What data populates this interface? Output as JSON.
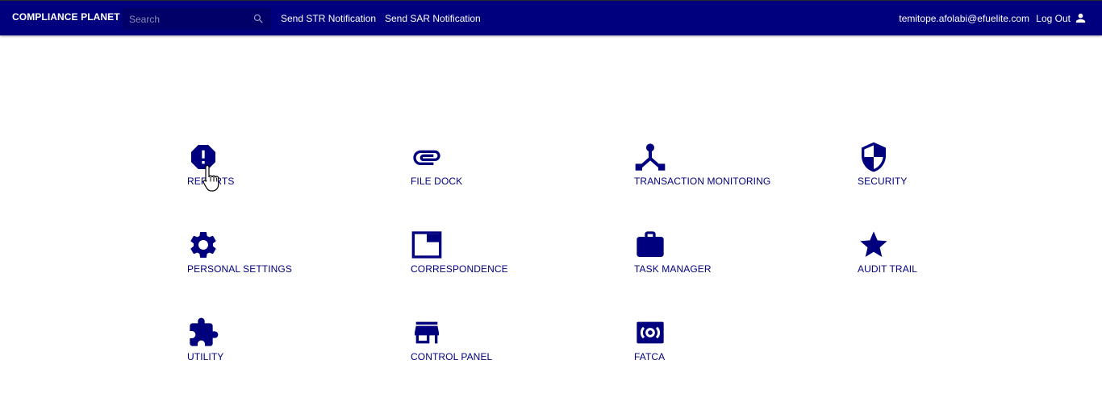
{
  "header": {
    "brand": "COMPLIANCE PLANET",
    "search_placeholder": "Search",
    "search_icon": "search-icon",
    "links": [
      {
        "label": "Send STR Notification"
      },
      {
        "label": "Send SAR Notification"
      }
    ],
    "user_email": "temitope.afolabi@efuelite.com",
    "logout_label": "Log Out",
    "logout_icon": "person-icon"
  },
  "theme": {
    "navy": "#00007e",
    "search_bg": "#000068",
    "background": "#ffffff"
  },
  "modules": [
    {
      "label": "REPORTS",
      "icon": "alert-octagon-icon"
    },
    {
      "label": "FILE DOCK",
      "icon": "paperclip-icon"
    },
    {
      "label": "TRANSACTION MONITORING",
      "icon": "network-icon"
    },
    {
      "label": "SECURITY",
      "icon": "shield-icon"
    },
    {
      "label": "PERSONAL SETTINGS",
      "icon": "gear-icon"
    },
    {
      "label": "CORRESPONDENCE",
      "icon": "window-icon"
    },
    {
      "label": "TASK MANAGER",
      "icon": "briefcase-icon"
    },
    {
      "label": "AUDIT TRAIL",
      "icon": "star-icon"
    },
    {
      "label": "UTILITY",
      "icon": "puzzle-icon"
    },
    {
      "label": "CONTROL PANEL",
      "icon": "store-icon"
    },
    {
      "label": "FATCA",
      "icon": "broadcast-icon"
    }
  ]
}
